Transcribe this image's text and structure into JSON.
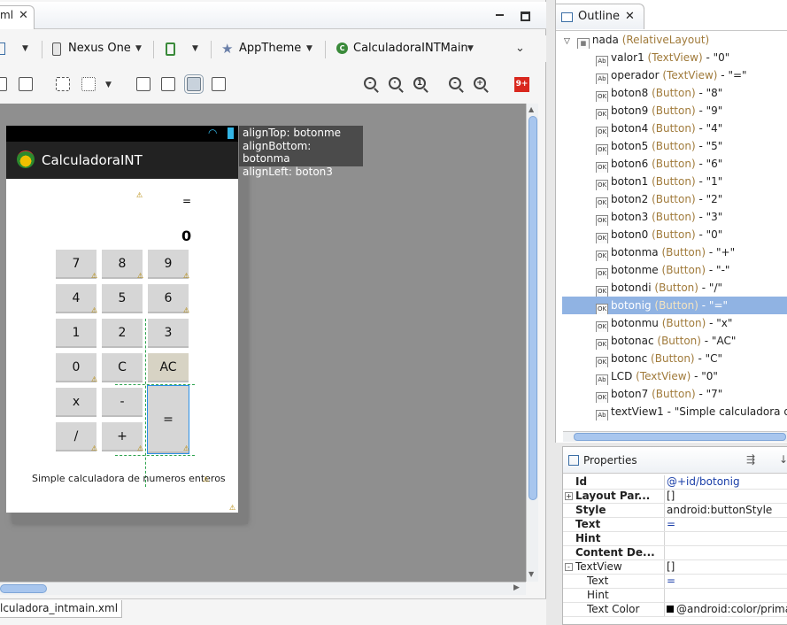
{
  "editor": {
    "tab_label": "ml",
    "toolbar": {
      "device": "Nexus One",
      "theme": "AppTheme",
      "activity": "CalculadoraINTMain"
    },
    "bottom_tab": "lculadora_intmain.xml",
    "badge": "9+"
  },
  "phone": {
    "app_title": "CalculadoraINT",
    "operator": "=",
    "lcd": "0",
    "buttons": [
      "7",
      "8",
      "9",
      "4",
      "5",
      "6",
      "1",
      "2",
      "3",
      "0",
      "C",
      "AC",
      "x",
      "-",
      "=",
      "/",
      "+"
    ],
    "caption": "Simple calculadora de numeros enteros"
  },
  "tooltip": {
    "line1": "alignTop: botonme",
    "line2": "alignBottom: botonma",
    "line3": "alignLeft: boton3"
  },
  "outline": {
    "tab_label": "Outline",
    "root": {
      "name": "nada",
      "type": "(RelativeLayout)"
    },
    "items": [
      {
        "icon": "Ab",
        "name": "valor1",
        "type": "(TextView)",
        "value": "- \"0\""
      },
      {
        "icon": "Ab",
        "name": "operador",
        "type": "(TextView)",
        "value": "- \"=\""
      },
      {
        "icon": "OK",
        "name": "boton8",
        "type": "(Button)",
        "value": "- \"8\""
      },
      {
        "icon": "OK",
        "name": "boton9",
        "type": "(Button)",
        "value": "- \"9\""
      },
      {
        "icon": "OK",
        "name": "boton4",
        "type": "(Button)",
        "value": "- \"4\""
      },
      {
        "icon": "OK",
        "name": "boton5",
        "type": "(Button)",
        "value": "- \"5\""
      },
      {
        "icon": "OK",
        "name": "boton6",
        "type": "(Button)",
        "value": "- \"6\""
      },
      {
        "icon": "OK",
        "name": "boton1",
        "type": "(Button)",
        "value": "- \"1\""
      },
      {
        "icon": "OK",
        "name": "boton2",
        "type": "(Button)",
        "value": "- \"2\""
      },
      {
        "icon": "OK",
        "name": "boton3",
        "type": "(Button)",
        "value": "- \"3\""
      },
      {
        "icon": "OK",
        "name": "boton0",
        "type": "(Button)",
        "value": "- \"0\""
      },
      {
        "icon": "OK",
        "name": "botonma",
        "type": "(Button)",
        "value": "- \"+\""
      },
      {
        "icon": "OK",
        "name": "botonme",
        "type": "(Button)",
        "value": "- \"-\""
      },
      {
        "icon": "OK",
        "name": "botondi",
        "type": "(Button)",
        "value": "- \"/\""
      },
      {
        "icon": "OK",
        "name": "botonig",
        "type": "(Button)",
        "value": "- \"=\""
      },
      {
        "icon": "OK",
        "name": "botonmu",
        "type": "(Button)",
        "value": "- \"x\""
      },
      {
        "icon": "OK",
        "name": "botonac",
        "type": "(Button)",
        "value": "- \"AC\""
      },
      {
        "icon": "OK",
        "name": "botonc",
        "type": "(Button)",
        "value": "- \"C\""
      },
      {
        "icon": "Ab",
        "name": "LCD",
        "type": "(TextView)",
        "value": "- \"0\""
      },
      {
        "icon": "OK",
        "name": "boton7",
        "type": "(Button)",
        "value": "- \"7\""
      },
      {
        "icon": "Ab",
        "name": "textView1",
        "type": "",
        "value": "- \"Simple calculadora d"
      }
    ]
  },
  "properties": {
    "tab_label": "Properties",
    "rows": [
      {
        "key": "Id",
        "value": "@+id/botonig"
      },
      {
        "key": "Layout Par...",
        "value": "[]"
      },
      {
        "key": "Style",
        "value": "android:buttonStyle"
      },
      {
        "key": "Text",
        "value": "="
      },
      {
        "key": "Hint",
        "value": ""
      },
      {
        "key": "Content De...",
        "value": ""
      },
      {
        "key": "TextView",
        "value": "[]"
      },
      {
        "key": "Text",
        "value": "="
      },
      {
        "key": "Hint",
        "value": ""
      },
      {
        "key": "Text Color",
        "value": "@android:color/prima"
      }
    ]
  }
}
